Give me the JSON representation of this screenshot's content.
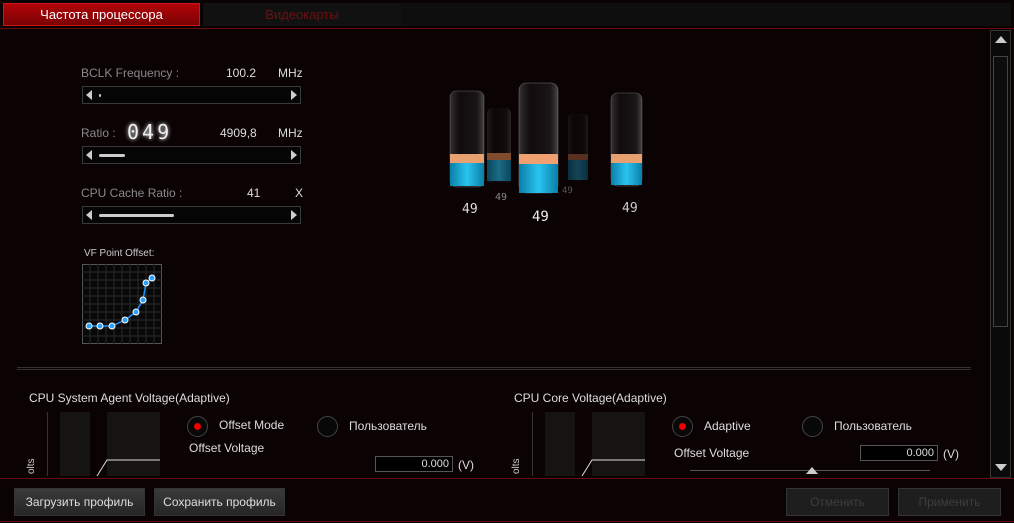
{
  "tabs": [
    {
      "label": "Частота процессора",
      "active": true
    },
    {
      "label": "Видеокарты",
      "active": false
    }
  ],
  "bclk": {
    "label": "BCLK Frequency :",
    "value": "100.2",
    "unit": "MHz",
    "fill": 0.01
  },
  "ratio": {
    "label": "Ratio :",
    "digital": "049",
    "value": "4909,8",
    "unit": "MHz",
    "fill": 0.14
  },
  "cache": {
    "label": "CPU Cache Ratio :",
    "value": "41",
    "unit": "X",
    "fill": 0.4
  },
  "vf": {
    "label": "VF Point Offset:"
  },
  "cores": [
    {
      "value": "49"
    },
    {
      "value": "49"
    },
    {
      "value": "49"
    },
    {
      "value": "49"
    },
    {
      "value": "49"
    }
  ],
  "sa_voltage": {
    "title": "CPU System Agent Voltage(Adaptive)",
    "axis": "olts",
    "mode1": "Offset Mode",
    "mode2": "Пользователь",
    "offset_label": "Offset Voltage",
    "value": "0.000",
    "unit": "(V)"
  },
  "core_voltage": {
    "title": "CPU Core Voltage(Adaptive)",
    "axis": "olts",
    "mode1": "Adaptive",
    "mode2": "Пользователь",
    "offset_label": "Offset Voltage",
    "value": "0.000",
    "unit": "(V)"
  },
  "footer": {
    "load": "Загрузить профиль",
    "save": "Сохранить профиль",
    "cancel": "Отменить",
    "apply": "Применить"
  }
}
